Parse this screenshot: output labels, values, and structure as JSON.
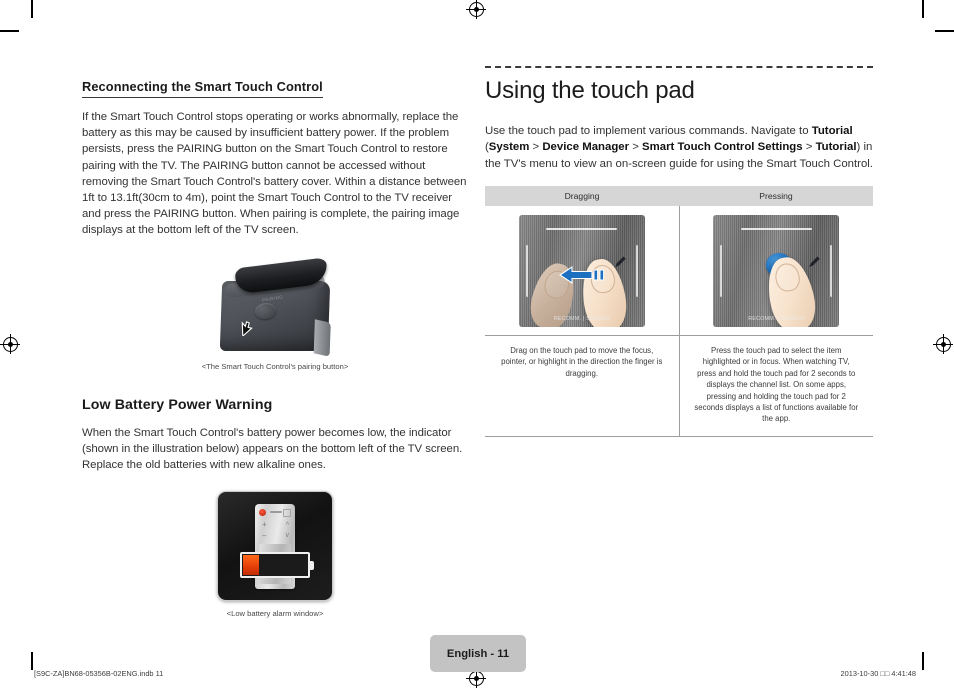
{
  "document": {
    "page_badge": "English - 11",
    "footer_left": "[S9C-ZA]BN68-05356B-02ENG.indb   11",
    "footer_right": "2013-10-30   □□ 4:41:48"
  },
  "left_column": {
    "section1": {
      "heading": "Reconnecting the Smart Touch Control",
      "body": "If the Smart Touch Control stops operating or works abnormally, replace the battery as this may be caused by insufficient battery power. If the problem persists, press the PAIRING button on the Smart Touch Control to restore pairing with the TV. The PAIRING button cannot be accessed without removing the Smart Touch Control's battery cover. Within a distance between 1ft to 13.1ft(30cm to 4m), point the Smart Touch Control to the TV receiver and press the PAIRING button. When pairing is complete, the pairing image displays at the bottom left of the TV screen.",
      "figure_caption": "<The Smart Touch Control's pairing button>",
      "figure_button_label": "PAIRING"
    },
    "section2": {
      "heading": "Low Battery Power Warning",
      "body": "When the Smart Touch Control's battery power becomes low, the indicator (shown in the illustration below) appears on the bottom left of the TV screen. Replace the old batteries with new alkaline ones.",
      "figure_caption": "<Low battery alarm window>"
    }
  },
  "right_column": {
    "title": "Using the touch pad",
    "intro": {
      "part1": "Use the touch pad to implement various commands. Navigate to ",
      "bold1": "Tutorial",
      "part2": " (",
      "bold2": "System",
      "sep1": " > ",
      "bold3": "Device Manager",
      "sep2": " > ",
      "bold4": "Smart Touch Control Settings",
      "sep3": " > ",
      "bold5": "Tutorial",
      "part3": ") in the TV's menu to view an on-screen guide for using the Smart Touch Control."
    },
    "table": {
      "headers": [
        "Dragging",
        "Pressing"
      ],
      "touchpad_label": "RECOMM. | SEARCH",
      "captions": [
        "Drag on the touch pad to move the focus, pointer, or highlight in the direction the finger is dragging.",
        "Press the touch pad to select the item highlighted or in focus. When watching TV, press and hold the touch pad for 2 seconds to displays the channel list. On some apps, pressing and holding the touch pad for 2 seconds displays a list of functions available for the app."
      ]
    }
  },
  "colors": {
    "table_header_bg": "#d6d6d6",
    "table_border": "#9d9d9d",
    "badge_bg": "#c3c3c3",
    "accent_blue": "#1c72c2",
    "battery_orange": "#e8400a"
  }
}
